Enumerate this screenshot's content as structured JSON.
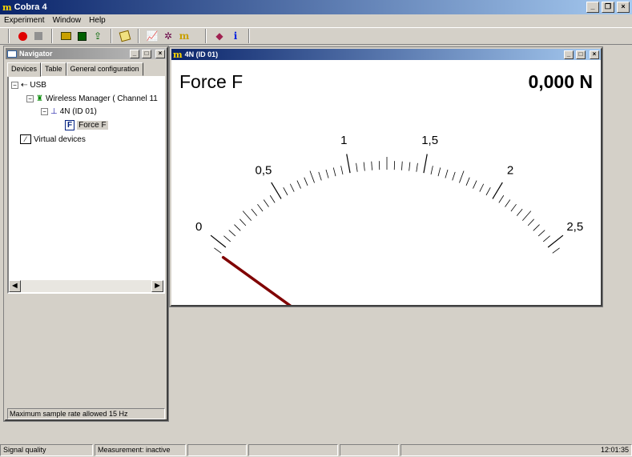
{
  "app": {
    "title": "Cobra 4",
    "logo": "m"
  },
  "menu": [
    {
      "label": "Experiment"
    },
    {
      "label": "Window"
    },
    {
      "label": "Help"
    }
  ],
  "toolbar": {
    "icons": [
      "record-icon",
      "stop-icon",
      "open-folder-icon",
      "save-icon",
      "export-icon",
      "notes-icon",
      "graph-icon",
      "analysis-icon",
      "cobra-logo-icon",
      "book-icon",
      "info-icon"
    ]
  },
  "navigator": {
    "title": "Navigator",
    "tabs": [
      "Devices",
      "Table",
      "General configuration"
    ],
    "tree": [
      "USB",
      "Wireless Manager ( Channel 11",
      "4N (ID 01)",
      "Force F",
      "Virtual devices"
    ],
    "footer": "Maximum sample rate allowed 15 Hz"
  },
  "meter": {
    "title": "4N (ID 01)",
    "label": "Force F",
    "value_text": "0,000 N",
    "value": 0,
    "min": 0,
    "max": 2.5,
    "tick_labels": [
      "0",
      "0,5",
      "1",
      "1,5",
      "2",
      "2,5"
    ],
    "needle_color": "#800000"
  },
  "status": {
    "cells": [
      "Signal quality",
      "Measurement: inactive",
      "",
      "",
      "",
      "",
      ""
    ],
    "time": "12:01:35"
  }
}
